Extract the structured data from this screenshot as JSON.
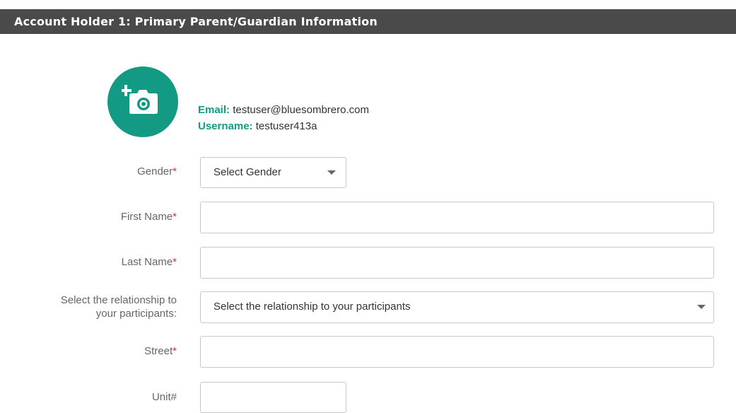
{
  "header": {
    "title": "Account Holder 1: Primary Parent/Guardian Information"
  },
  "account": {
    "email_label": "Email:",
    "email": "testuser@bluesombrero.com",
    "username_label": "Username:",
    "username": "testuser413a"
  },
  "form": {
    "gender": {
      "label": "Gender",
      "required_mark": "*",
      "selected": "Select Gender"
    },
    "first_name": {
      "label": "First Name",
      "required_mark": "*",
      "value": ""
    },
    "last_name": {
      "label": "Last Name",
      "required_mark": "*",
      "value": ""
    },
    "relationship": {
      "label_line1": "Select the relationship to",
      "label_line2": "your participants:",
      "selected": "Select the relationship to your participants"
    },
    "street": {
      "label": "Street",
      "required_mark": "*",
      "value": ""
    },
    "unit": {
      "label": "Unit#",
      "value": ""
    }
  },
  "colors": {
    "accent": "#139a84",
    "header_bg": "#4a4a4a",
    "required": "#c0392b"
  },
  "icons": {
    "avatar": "add-photo-camera-icon",
    "dropdown": "caret-down-icon"
  }
}
